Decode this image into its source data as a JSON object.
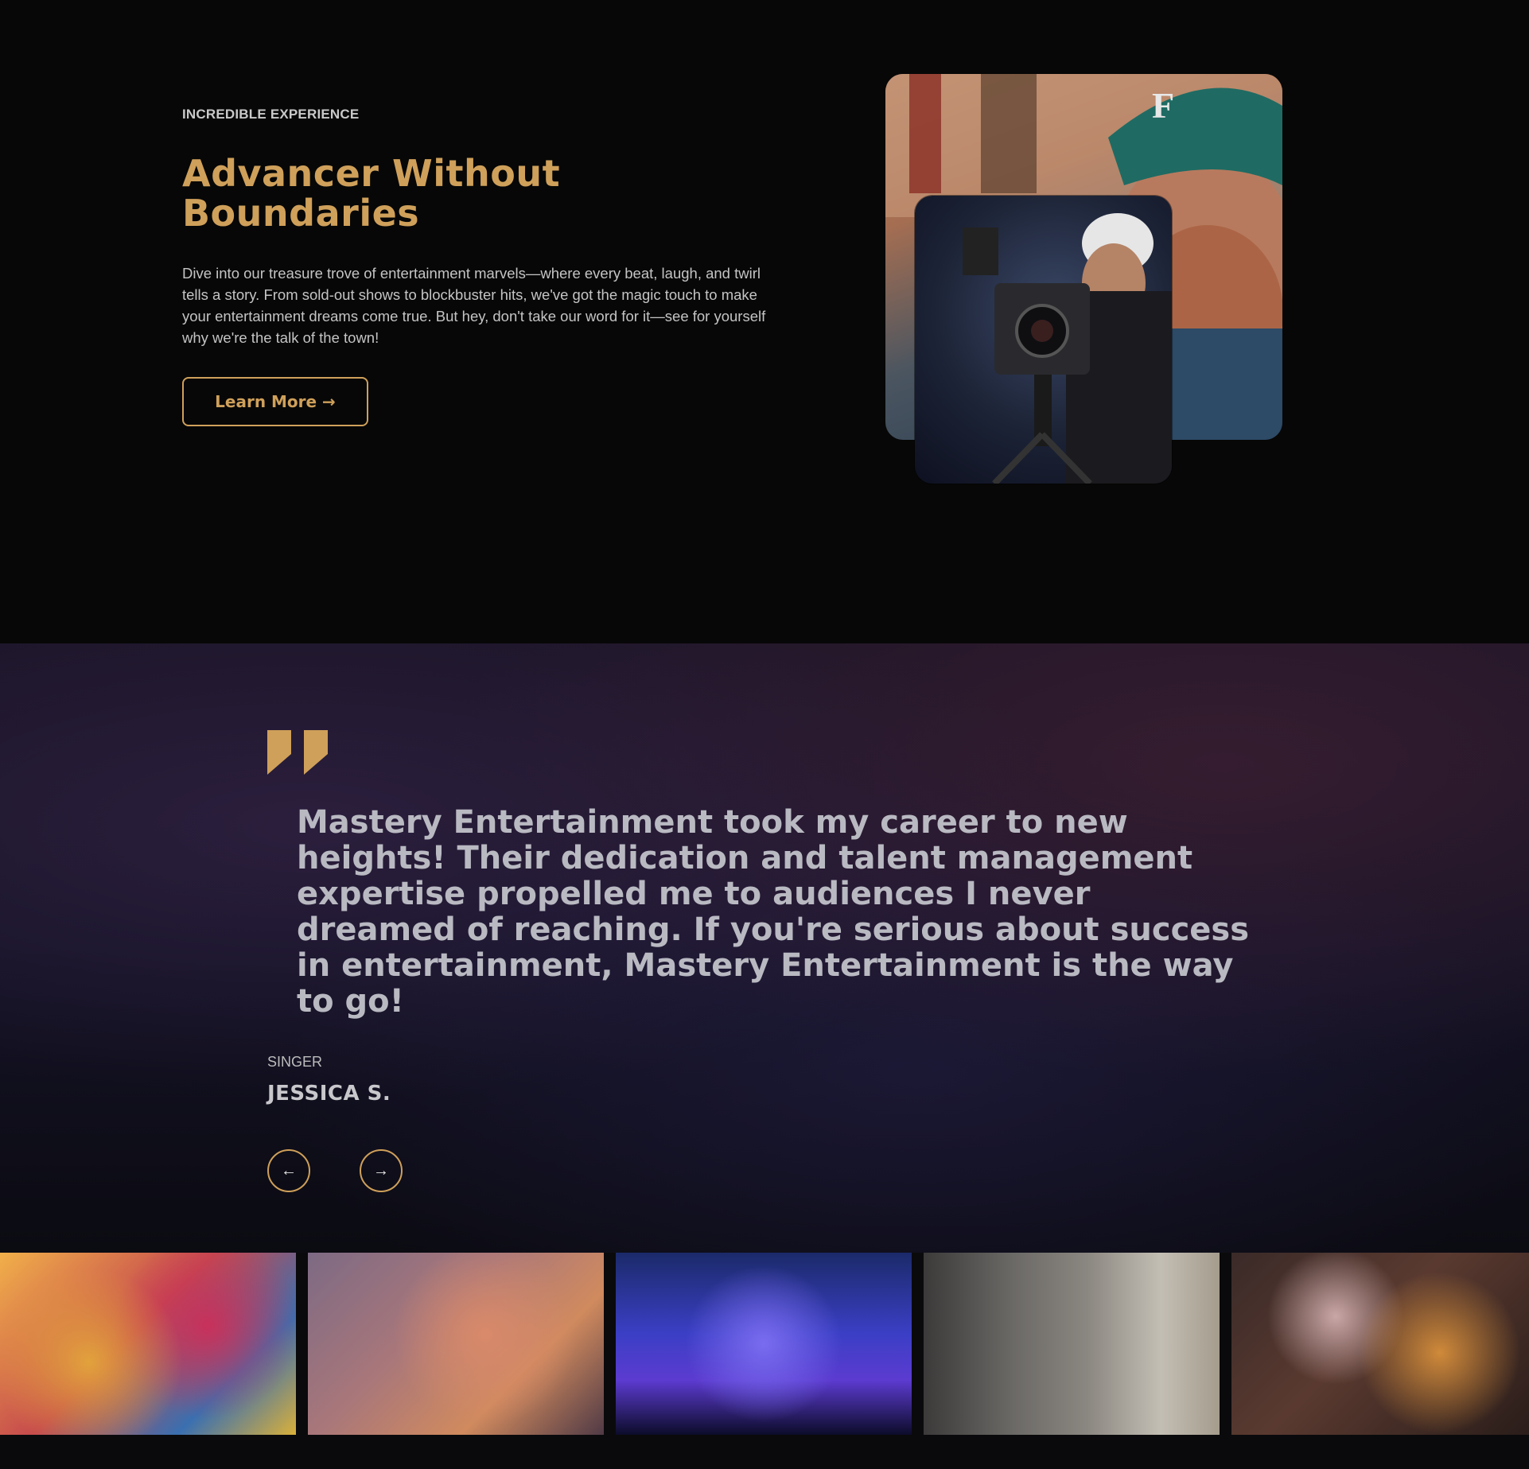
{
  "hero": {
    "eyebrow": "INCREDIBLE EXPERIENCE",
    "title": "Advancer Without Boundaries",
    "body": "Dive into our treasure trove of entertainment marvels—where every beat, laugh, and twirl tells a story. From sold-out shows to blockbuster hits, we've got the magic touch to make your entertainment dreams come true. But hey, don't take our word for it—see for yourself why we're the talk of the town!",
    "button_label": "Learn More →"
  },
  "testimonial": {
    "quote": "Mastery Entertainment took my career to new heights! Their dedication and talent management expertise propelled me to audiences I never dreamed of reaching. If you're serious about success in entertainment, Mastery Entertainment is the way to go!",
    "role": "SINGER",
    "name": "JESSICA S.",
    "prev_label": "←",
    "next_label": "→"
  },
  "gallery": {
    "items": [
      "crowd-celebration",
      "friends-toasting",
      "concert-stage",
      "film-set",
      "party-sparklers"
    ]
  },
  "colors": {
    "accent": "#cfa05a",
    "background": "#070707"
  }
}
